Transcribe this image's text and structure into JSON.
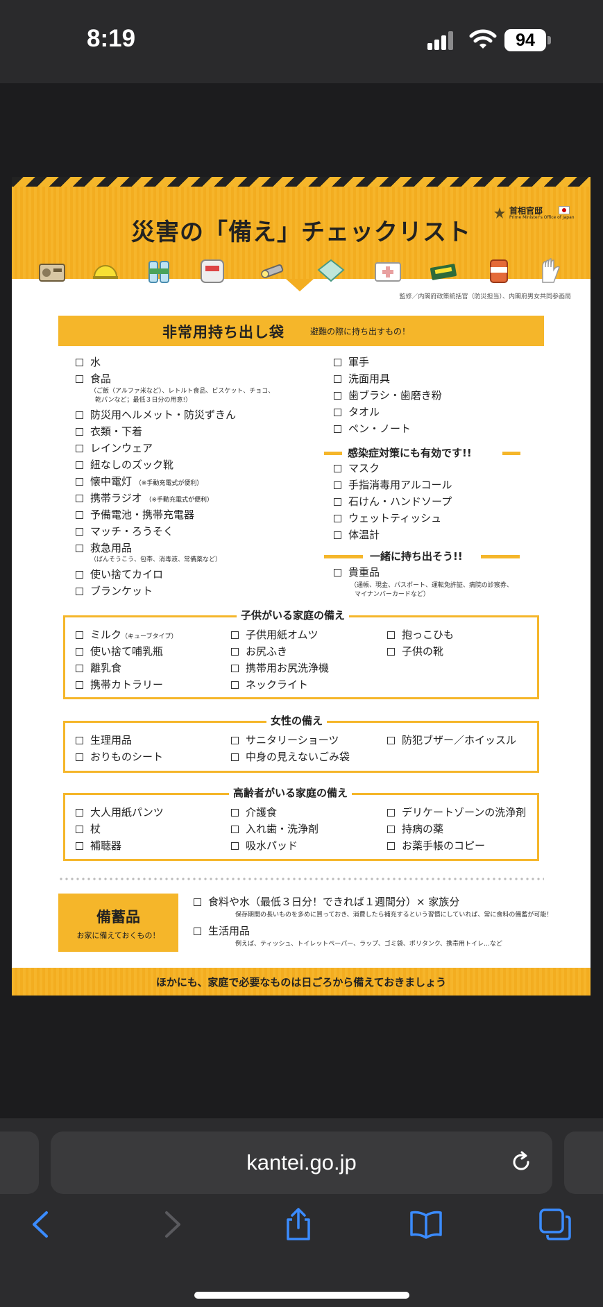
{
  "status_bar": {
    "time": "8:19",
    "battery": "94"
  },
  "document": {
    "title": "災害の「備え」チェックリスト",
    "logo_text": "首相官邸",
    "logo_en": "Prime Minister's Office of Japan",
    "supervision": "監修／内閣府政策統括官（防災担当）、内閣府男女共同参画局",
    "header_icons": [
      "radio-icon",
      "helmet-icon",
      "water-bottles-icon",
      "emergency-bag-icon",
      "flashlight-icon",
      "food-pack-icon",
      "first-aid-kit-icon",
      "wallet-icon",
      "canned-food-icon",
      "gloves-icon"
    ],
    "emergency_bag": {
      "title": "非常用持ち出し袋",
      "subtitle": "避難の際に持ち出すもの！",
      "left_items": [
        "水",
        "食品",
        "防災用ヘルメット・防災ずきん",
        "衣類・下着",
        "レインウェア",
        "紐なしのズック靴",
        "懐中電灯",
        "携帯ラジオ",
        "予備電池・携帯充電器",
        "マッチ・ろうそく",
        "救急用品",
        "使い捨てカイロ",
        "ブランケット"
      ],
      "food_note_1": "（ご飯（アルファ米など）、レトルト食品、ビスケット、チョコ、",
      "food_note_2": "乾パンなど；最低３日分の用意!）",
      "flashlight_note": "（※手動充電式が便利）",
      "radio_note": "（※手動充電式が便利）",
      "first_aid_note": "（ばんそうこう、包帯、消毒液、常備薬など）",
      "right_items": [
        "軍手",
        "洗面用具",
        "歯ブラシ・歯磨き粉",
        "タオル",
        "ペン・ノート"
      ],
      "infection_title": "感染症対策にも有効です!!",
      "infection_items": [
        "マスク",
        "手指消毒用アルコール",
        "石けん・ハンドソープ",
        "ウェットティッシュ",
        "体温計"
      ],
      "together_title": "一緒に持ち出そう!!",
      "valuables": "貴重品",
      "valuables_note_1": "（通帳、現金、パスポート、運転免許証、病院の診察券、",
      "valuables_note_2": "マイナンバーカードなど）"
    },
    "children": {
      "title": "子供がいる家庭の備え",
      "col1": [
        "ミルク",
        "使い捨て哺乳瓶",
        "離乳食",
        "携帯カトラリー"
      ],
      "milk_note": "（キューブタイプ）",
      "col2": [
        "子供用紙オムツ",
        "お尻ふき",
        "携帯用お尻洗浄機",
        "ネックライト"
      ],
      "col3": [
        "抱っこひも",
        "子供の靴"
      ]
    },
    "women": {
      "title": "女性の備え",
      "col1": [
        "生理用品",
        "おりものシート"
      ],
      "col2": [
        "サニタリーショーツ",
        "中身の見えないごみ袋"
      ],
      "col3": [
        "防犯ブザー／ホイッスル"
      ]
    },
    "elderly": {
      "title": "高齢者がいる家庭の備え",
      "col1": [
        "大人用紙パンツ",
        "杖",
        "補聴器"
      ],
      "col2": [
        "介護食",
        "入れ歯・洗浄剤",
        "吸水パッド"
      ],
      "col3": [
        "デリケートゾーンの洗浄剤",
        "持病の薬",
        "お薬手帳のコピー"
      ]
    },
    "stockpile": {
      "title": "備蓄品",
      "subtitle": "お家に備えておくもの！",
      "item1": "食料や水（最低３日分！できれば１週間分）× 家族分",
      "item1_note": "保存期間の長いものを多めに買っておき、消費したら補充するという習慣にしていれば、常に食料の備蓄が可能！",
      "item2": "生活用品",
      "item2_note": "例えば、ティッシュ、トイレットペーパー、ラップ、ゴミ袋、ポリタンク、携帯用トイレ…など"
    },
    "footer": "ほかにも、家庭で必要なものは日ごろから備えておきましょう"
  },
  "browser": {
    "address": "kantei.go.jp"
  }
}
